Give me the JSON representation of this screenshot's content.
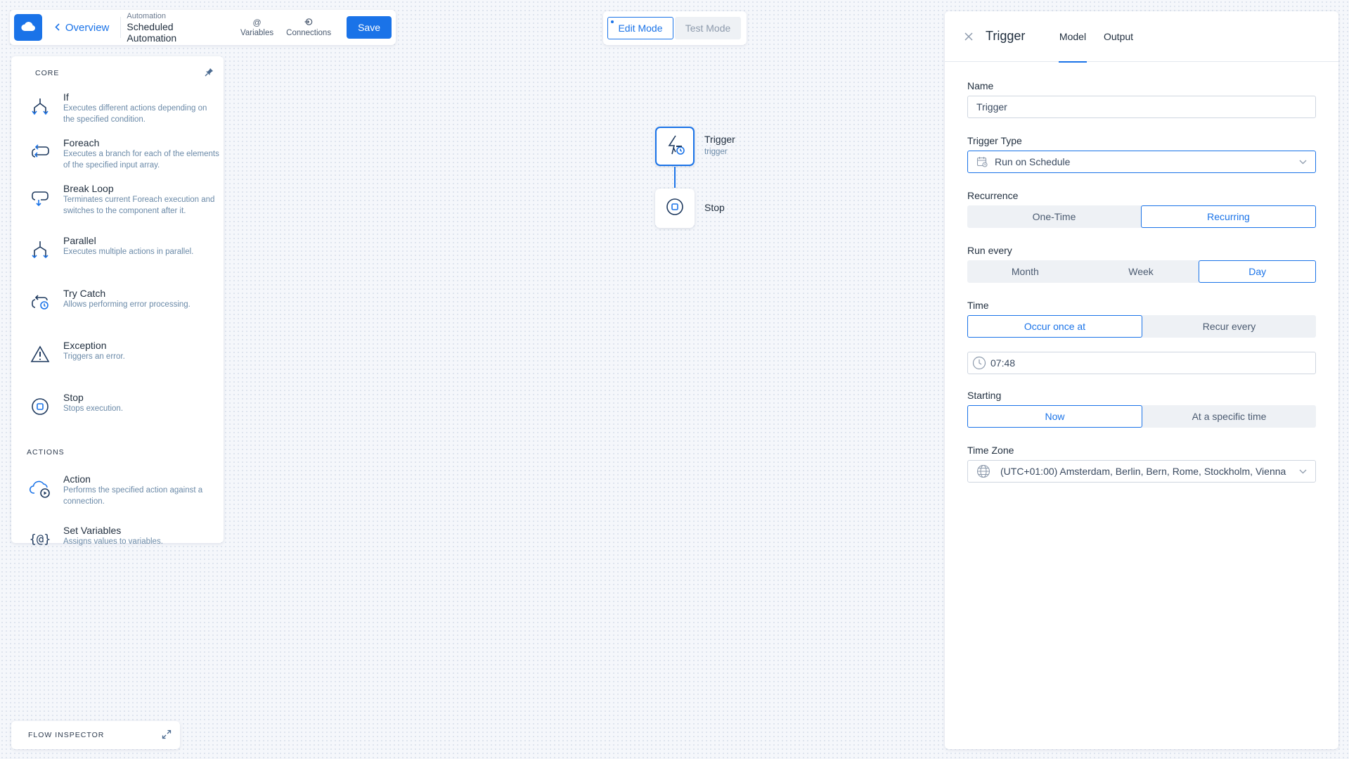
{
  "topbar": {
    "logo_icon": "cloud-icon",
    "back_label": "Overview",
    "automation_label": "Automation",
    "automation_name": "Scheduled Automation",
    "variables_icon": "@",
    "variables_label": "Variables",
    "connections_label": "Connections",
    "save_label": "Save"
  },
  "modes": {
    "edit_label": "Edit Mode",
    "test_label": "Test Mode",
    "active": "Edit Mode"
  },
  "palette": {
    "core_heading": "CORE",
    "core_items": [
      {
        "name": "If",
        "desc": "Executes different actions depending on the specified condition.",
        "icon": "if-branch-icon"
      },
      {
        "name": "Foreach",
        "desc": "Executes a branch for each of the elements of the specified input array.",
        "icon": "foreach-loop-icon"
      },
      {
        "name": "Break Loop",
        "desc": "Terminates current Foreach execution and switches to the component after it.",
        "icon": "break-loop-icon"
      },
      {
        "name": "Parallel",
        "desc": "Executes multiple actions in parallel.",
        "icon": "parallel-icon"
      },
      {
        "name": "Try Catch",
        "desc": "Allows performing error processing.",
        "icon": "try-catch-icon"
      },
      {
        "name": "Exception",
        "desc": "Triggers an error.",
        "icon": "warning-triangle-icon"
      },
      {
        "name": "Stop",
        "desc": "Stops execution.",
        "icon": "stop-icon"
      }
    ],
    "actions_heading": "ACTIONS",
    "action_items": [
      {
        "name": "Action",
        "desc": "Performs the specified action against a connection.",
        "icon": "cloud-play-icon"
      },
      {
        "name": "Set Variables",
        "desc": "Assigns values to variables.",
        "icon": "set-variables-icon",
        "glyph": "{@}"
      }
    ]
  },
  "canvas": {
    "nodes": [
      {
        "label": "Trigger",
        "sub": "trigger",
        "icon": "trigger-schedule-icon"
      },
      {
        "label": "Stop",
        "sub": "",
        "icon": "stop-icon"
      }
    ]
  },
  "flow_inspector": {
    "label": "FLOW INSPECTOR"
  },
  "panel": {
    "title": "Trigger",
    "tabs": [
      "Model",
      "Output"
    ],
    "active_tab": "Model",
    "name_label": "Name",
    "name_value": "Trigger",
    "trigger_type_label": "Trigger Type",
    "trigger_type_value": "Run on Schedule",
    "recurrence_label": "Recurrence",
    "recurrence_options": [
      "One-Time",
      "Recurring"
    ],
    "recurrence_selected": "Recurring",
    "run_every_label": "Run every",
    "run_every_options": [
      "Month",
      "Week",
      "Day"
    ],
    "run_every_selected": "Day",
    "time_label": "Time",
    "time_options": [
      "Occur once at",
      "Recur every"
    ],
    "time_selected": "Occur once at",
    "time_value": "07:48",
    "starting_label": "Starting",
    "starting_options": [
      "Now",
      "At a specific time"
    ],
    "starting_selected": "Now",
    "timezone_label": "Time Zone",
    "timezone_value": "(UTC+01:00) Amsterdam, Berlin, Bern, Rome, Stockholm, Vienna"
  },
  "colors": {
    "accent": "#1a73e8",
    "text": "#1f2d3d",
    "muted": "#6b8aa8",
    "canvas_bg": "#f5f7fb"
  }
}
